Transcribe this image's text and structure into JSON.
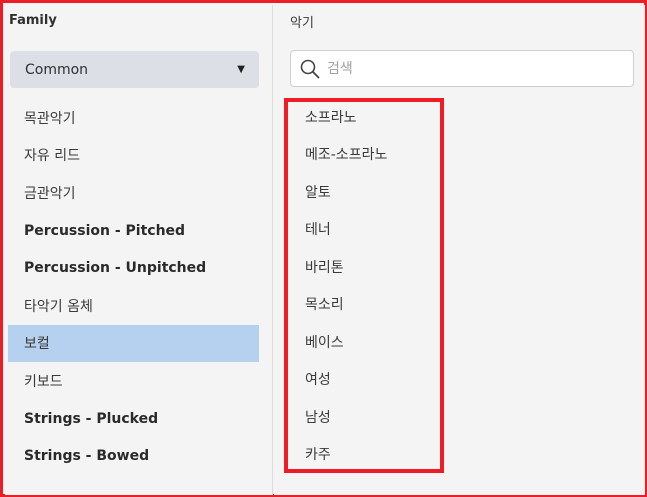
{
  "family_panel": {
    "title": "Family",
    "filter": {
      "selected": "Common",
      "caret": "▼"
    },
    "items": [
      {
        "label": "목관악기",
        "bold": false,
        "selected": false
      },
      {
        "label": "자유 리드",
        "bold": false,
        "selected": false
      },
      {
        "label": "금관악기",
        "bold": false,
        "selected": false
      },
      {
        "label": "Percussion - Pitched",
        "bold": true,
        "selected": false
      },
      {
        "label": "Percussion - Unpitched",
        "bold": true,
        "selected": false
      },
      {
        "label": "타악기 옴체",
        "bold": false,
        "selected": false
      },
      {
        "label": "보컬",
        "bold": false,
        "selected": true
      },
      {
        "label": "키보드",
        "bold": false,
        "selected": false
      },
      {
        "label": "Strings - Plucked",
        "bold": true,
        "selected": false
      },
      {
        "label": "Strings - Bowed",
        "bold": true,
        "selected": false
      }
    ]
  },
  "instrument_panel": {
    "title": "악기",
    "search": {
      "placeholder": "검색",
      "value": ""
    },
    "items": [
      "소프라노",
      "메조-소프라노",
      "알토",
      "테너",
      "바리톤",
      "목소리",
      "베이스",
      "여성",
      "남성",
      "카주"
    ]
  },
  "colors": {
    "annotation_red": "#ee1c25",
    "selection_blue": "#b5d1ef",
    "panel_bg": "#f4f4f5",
    "dropdown_bg": "#dcdfe5"
  },
  "icons": {
    "search": "magnifier-icon",
    "dropdown": "caret-down-icon"
  }
}
